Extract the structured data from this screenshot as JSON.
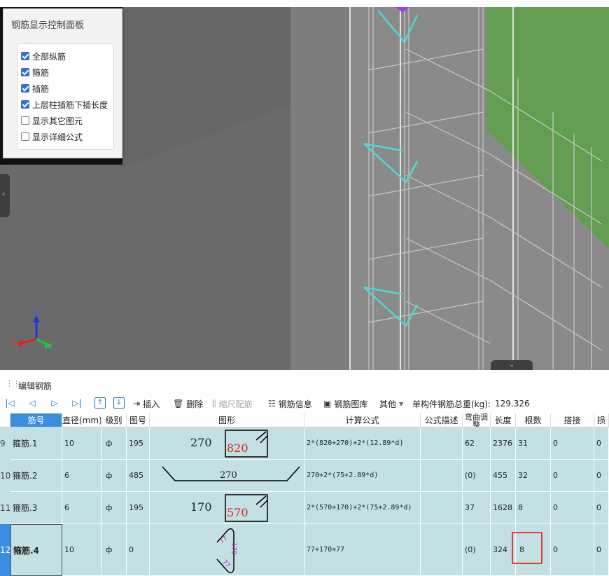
{
  "control_panel": {
    "title": "钢筋显示控制面板",
    "options": [
      {
        "label": "全部纵筋",
        "checked": true
      },
      {
        "label": "箍筋",
        "checked": true
      },
      {
        "label": "插筋",
        "checked": true
      },
      {
        "label": "上层柱插筋下插长度",
        "checked": true
      },
      {
        "label": "显示其它图元",
        "checked": false
      },
      {
        "label": "显示详细公式",
        "checked": false
      }
    ]
  },
  "axis": {
    "x": "X",
    "y": "Y",
    "z": "Z"
  },
  "edit_panel": {
    "title": "编辑钢筋",
    "toolbar": {
      "insert": "插入",
      "delete": "删除",
      "scale_rebar": "缩尺配筋",
      "rebar_info": "钢筋信息",
      "rebar_library": "钢筋图库",
      "other": "其他",
      "total_weight_label": "单构件钢筋总重(kg):",
      "total_weight_value": "129.326"
    },
    "columns": [
      "筋号",
      "直径(mm)",
      "级别",
      "图号",
      "图形",
      "计算公式",
      "公式描述",
      "弯曲调整",
      "长度",
      "根数",
      "搭接",
      "损"
    ],
    "rows": [
      {
        "index": "9",
        "name": "箍筋.1",
        "diameter": "10",
        "grade": "ф",
        "shape_no": "195",
        "shape_values": [
          "270",
          "820"
        ],
        "formula": "2*(820+270)+2*(12.89*d)",
        "bend_adjust": "62",
        "length": "2376",
        "count": "31",
        "lap": "0",
        "loss": "0"
      },
      {
        "index": "10",
        "name": "箍筋.2",
        "diameter": "6",
        "grade": "ф",
        "shape_no": "485",
        "shape_values": [
          "270"
        ],
        "formula": "270+2*(75+2.89*d)",
        "bend_adjust": "(0)",
        "length": "455",
        "count": "32",
        "lap": "0",
        "loss": "0"
      },
      {
        "index": "11",
        "name": "箍筋.3",
        "diameter": "6",
        "grade": "ф",
        "shape_no": "195",
        "shape_values": [
          "170",
          "570"
        ],
        "formula": "2*(570+170)+2*(75+2.89*d)",
        "bend_adjust": "37",
        "length": "1628",
        "count": "8",
        "lap": "0",
        "loss": "0"
      },
      {
        "index": "12",
        "name": "箍筋.4",
        "diameter": "10",
        "grade": "ф",
        "shape_no": "0",
        "shape_values": [
          "77",
          "170",
          "77"
        ],
        "formula": "77+170+77",
        "bend_adjust": "(0)",
        "length": "324",
        "count": "8",
        "lap": "0",
        "loss": "0"
      }
    ]
  },
  "colors": {
    "accent": "#3a8ee0",
    "grid_bg": "#c3e1e3",
    "highlight": "#e53935",
    "rebar_stirrup": "#4fd8d8",
    "slab": "#5aa048"
  }
}
